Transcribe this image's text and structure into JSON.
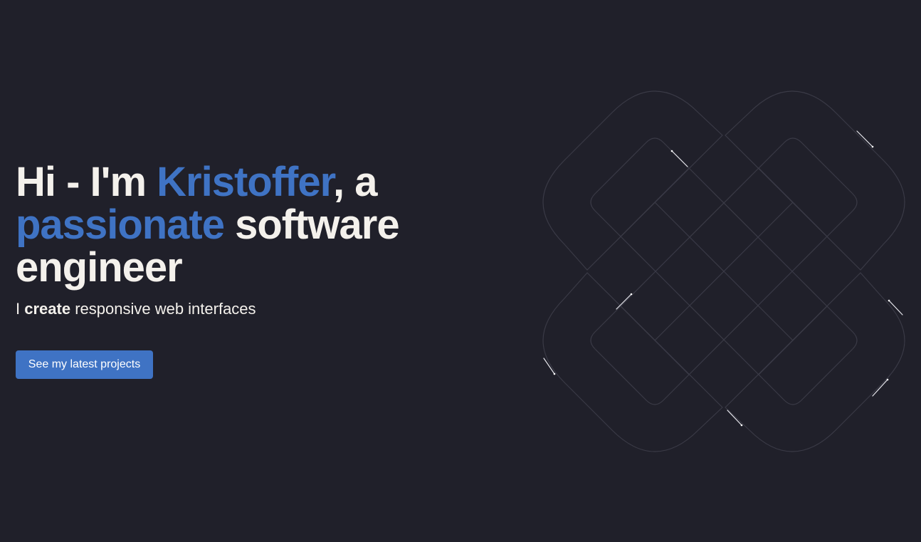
{
  "hero": {
    "title_part1": "Hi - I'm ",
    "name": "Kristoffer",
    "title_part2": ", a ",
    "adjective": "passionate",
    "title_part3": " software engineer",
    "subtitle_part1": "I ",
    "subtitle_emphasis": "create",
    "subtitle_part2": " responsive web interfaces"
  },
  "cta": {
    "label": "See my latest projects"
  },
  "colors": {
    "background": "#20202a",
    "accent": "#3f73c4",
    "text": "#f4f1ec",
    "decoration_stroke": "#3a3a46"
  }
}
